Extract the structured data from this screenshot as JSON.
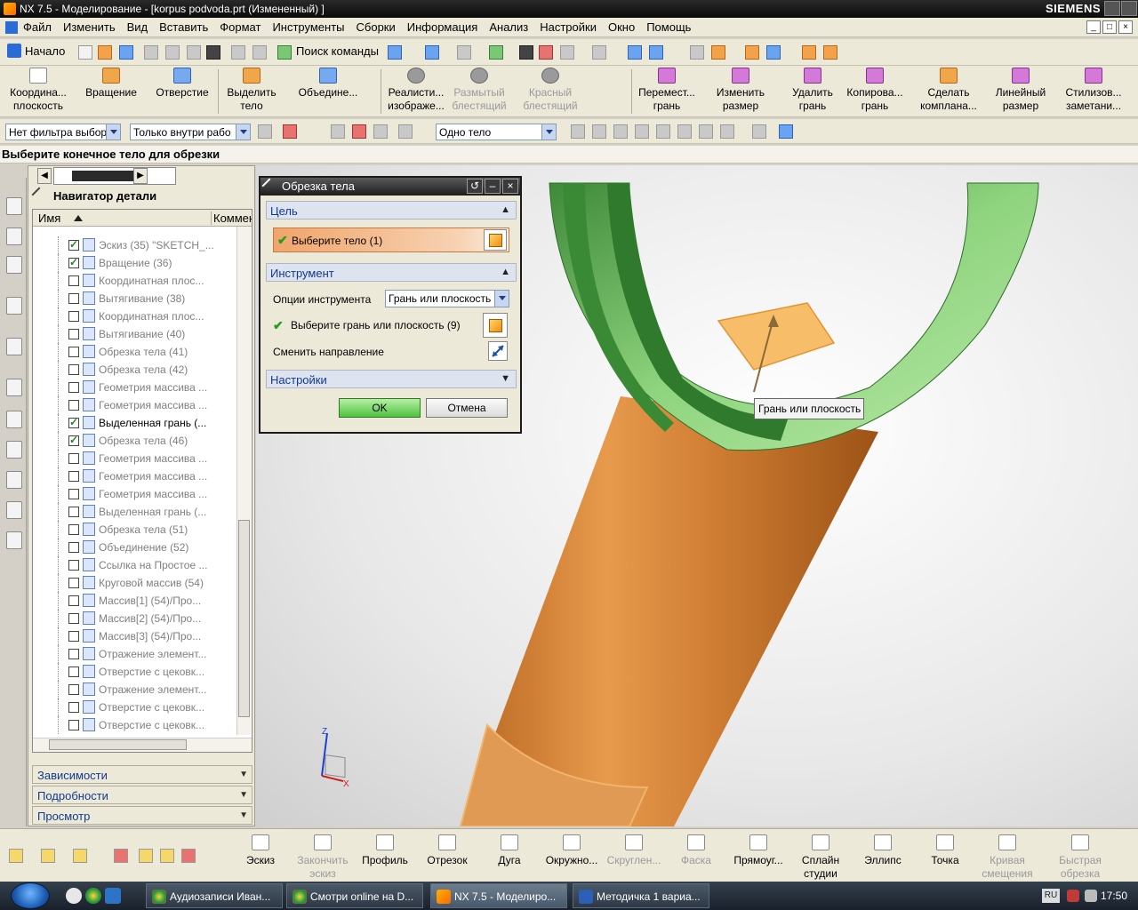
{
  "window": {
    "title": "NX 7.5 - Моделирование - [korpus podvoda.prt (Измененный) ]",
    "brand": "SIEMENS",
    "controls": [
      "_",
      "□",
      "×"
    ]
  },
  "menu": [
    "Файл",
    "Изменить",
    "Вид",
    "Вставить",
    "Формат",
    "Инструменты",
    "Сборки",
    "Информация",
    "Анализ",
    "Настройки",
    "Окно",
    "Помощь"
  ],
  "toolbar": {
    "start_label": "Начало",
    "command_finder": "Поиск команды"
  },
  "ribbon": [
    {
      "label1": "Координа...",
      "label2": "плоскость",
      "disabled": false
    },
    {
      "label1": "Вращение",
      "label2": "",
      "disabled": false
    },
    {
      "label1": "Отверстие",
      "label2": "",
      "disabled": false
    },
    {
      "label1": "Выделить",
      "label2": "тело",
      "disabled": false
    },
    {
      "label1": "Объедине...",
      "label2": "",
      "disabled": false
    },
    {
      "label1": "Реалисти...",
      "label2": "изображе...",
      "disabled": false
    },
    {
      "label1": "Размытый",
      "label2": "блестящий",
      "disabled": true
    },
    {
      "label1": "Красный",
      "label2": "блестящий",
      "disabled": true
    },
    {
      "label1": "Перемест...",
      "label2": "грань",
      "disabled": false
    },
    {
      "label1": "Изменить",
      "label2": "размер",
      "disabled": false
    },
    {
      "label1": "Удалить",
      "label2": "грань",
      "disabled": false
    },
    {
      "label1": "Копирова...",
      "label2": "грань",
      "disabled": false
    },
    {
      "label1": "Сделать",
      "label2": "комплана...",
      "disabled": false
    },
    {
      "label1": "Линейный",
      "label2": "размер",
      "disabled": false
    },
    {
      "label1": "Стилизов...",
      "label2": "заметани...",
      "disabled": false
    }
  ],
  "filters": {
    "type_filter": "Нет фильтра выбор",
    "scope_filter": "Только внутри рабо",
    "body_filter": "Одно тело"
  },
  "cue": "Выберите конечное тело для обрезки",
  "navigator": {
    "title": "Навигатор детали",
    "col_name": "Имя",
    "col_comment": "Коммен",
    "rows": [
      {
        "label": "Эскиз (35) \"SKETCH_...",
        "checked": true,
        "active": false
      },
      {
        "label": "Вращение (36)",
        "checked": true,
        "active": false
      },
      {
        "label": "Координатная плос...",
        "checked": false,
        "active": false
      },
      {
        "label": "Вытягивание (38)",
        "checked": false,
        "active": false
      },
      {
        "label": "Координатная плос...",
        "checked": false,
        "active": false
      },
      {
        "label": "Вытягивание (40)",
        "checked": false,
        "active": false
      },
      {
        "label": "Обрезка тела (41)",
        "checked": false,
        "active": false
      },
      {
        "label": "Обрезка тела (42)",
        "checked": false,
        "active": false
      },
      {
        "label": "Геометрия массива ...",
        "checked": false,
        "active": false
      },
      {
        "label": "Геометрия массива ...",
        "checked": false,
        "active": false
      },
      {
        "label": "Выделенная грань (...",
        "checked": true,
        "active": true
      },
      {
        "label": "Обрезка тела (46)",
        "checked": true,
        "active": false
      },
      {
        "label": "Геометрия массива ...",
        "checked": false,
        "active": false
      },
      {
        "label": "Геометрия массива ...",
        "checked": false,
        "active": false
      },
      {
        "label": "Геометрия массива ...",
        "checked": false,
        "active": false
      },
      {
        "label": "Выделенная грань (...",
        "checked": false,
        "active": false
      },
      {
        "label": "Обрезка тела (51)",
        "checked": false,
        "active": false
      },
      {
        "label": "Объединение (52)",
        "checked": false,
        "active": false
      },
      {
        "label": "Ссылка на Простое ...",
        "checked": false,
        "active": false
      },
      {
        "label": "Круговой массив (54)",
        "checked": false,
        "active": false
      },
      {
        "label": "Массив[1] (54)/Про...",
        "checked": false,
        "active": false
      },
      {
        "label": "Массив[2] (54)/Про...",
        "checked": false,
        "active": false
      },
      {
        "label": "Массив[3] (54)/Про...",
        "checked": false,
        "active": false
      },
      {
        "label": "Отражение элемент...",
        "checked": false,
        "active": false
      },
      {
        "label": "Отверстие с цековк...",
        "checked": false,
        "active": false
      },
      {
        "label": "Отражение элемент...",
        "checked": false,
        "active": false
      },
      {
        "label": "Отверстие с цековк...",
        "checked": false,
        "active": false
      },
      {
        "label": "Отверстие с цековк...",
        "checked": false,
        "active": false
      }
    ],
    "panels": [
      "Зависимости",
      "Подробности",
      "Просмотр"
    ]
  },
  "dialog": {
    "title": "Обрезка тела",
    "group_target": "Цель",
    "select_body": "Выберите тело (1)",
    "group_tool": "Инструмент",
    "tool_options_label": "Опции инструмента",
    "tool_options_value": "Грань или плоскость",
    "select_face": "Выберите грань или плоскость (9)",
    "reverse_direction": "Сменить направление",
    "group_settings": "Настройки",
    "ok": "OK",
    "cancel": "Отмена"
  },
  "tooltip": "Грань или плоскость",
  "triad": {
    "z": "Z",
    "x": "X"
  },
  "bottom_toolbar": [
    {
      "label1": "Эскиз",
      "label2": "",
      "disabled": false
    },
    {
      "label1": "Закончить",
      "label2": "эскиз",
      "disabled": true
    },
    {
      "label1": "Профиль",
      "label2": "",
      "disabled": false
    },
    {
      "label1": "Отрезок",
      "label2": "",
      "disabled": false
    },
    {
      "label1": "Дуга",
      "label2": "",
      "disabled": false
    },
    {
      "label1": "Окружно...",
      "label2": "",
      "disabled": false
    },
    {
      "label1": "Скруглен...",
      "label2": "",
      "disabled": true
    },
    {
      "label1": "Фаска",
      "label2": "",
      "disabled": true
    },
    {
      "label1": "Прямоуг...",
      "label2": "",
      "disabled": false
    },
    {
      "label1": "Сплайн",
      "label2": "студии",
      "disabled": false
    },
    {
      "label1": "Эллипс",
      "label2": "",
      "disabled": false
    },
    {
      "label1": "Точка",
      "label2": "",
      "disabled": false
    },
    {
      "label1": "Кривая",
      "label2": "смещения",
      "disabled": true
    },
    {
      "label1": "Быстрая",
      "label2": "обрезка",
      "disabled": true
    }
  ],
  "taskbar": {
    "tasks": [
      "Аудиозаписи Иван...",
      "Смотри online на D...",
      "NX 7.5 - Моделиро...",
      "Методичка 1 вариа..."
    ],
    "lang": "RU",
    "clock": "17:50"
  },
  "colors": {
    "body_orange": "#d9853a",
    "body_green": "#8fd47e",
    "selection_orange": "#f0a56a",
    "ok_green": "#4fc240"
  }
}
